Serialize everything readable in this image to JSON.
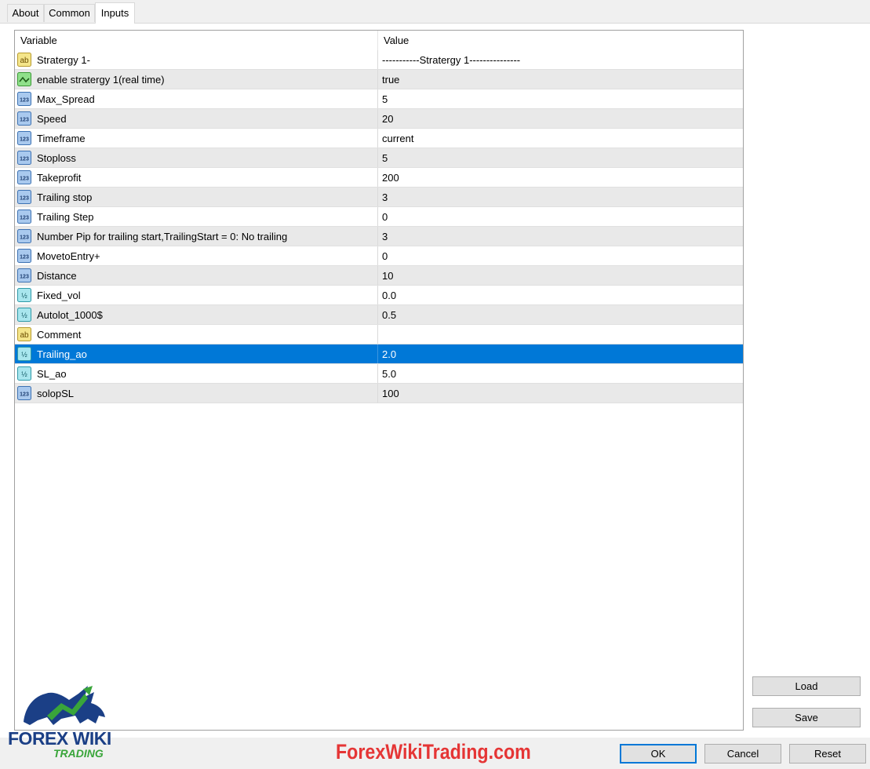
{
  "tabs": [
    {
      "label": "About"
    },
    {
      "label": "Common"
    },
    {
      "label": "Inputs"
    }
  ],
  "grid": {
    "headers": {
      "variable": "Variable",
      "value": "Value"
    },
    "rows": [
      {
        "name": "Stratergy 1-",
        "value": "-----------Stratergy 1---------------",
        "icon": "string-ab-icon"
      },
      {
        "name": "enable stratergy 1(real time)",
        "value": "true",
        "icon": "bool-toggle-icon"
      },
      {
        "name": "Max_Spread",
        "value": "5",
        "icon": "integer-123-icon"
      },
      {
        "name": "Speed",
        "value": "20",
        "icon": "integer-123-icon"
      },
      {
        "name": "Timeframe",
        "value": "current",
        "icon": "integer-123-icon"
      },
      {
        "name": "Stoploss",
        "value": "5",
        "icon": "integer-123-icon"
      },
      {
        "name": "Takeprofit",
        "value": "200",
        "icon": "integer-123-icon"
      },
      {
        "name": "Trailing stop",
        "value": "3",
        "icon": "integer-123-icon"
      },
      {
        "name": "Trailing Step",
        "value": "0",
        "icon": "integer-123-icon"
      },
      {
        "name": "Number Pip for trailing start,TrailingStart = 0: No trailing",
        "value": "3",
        "icon": "integer-123-icon"
      },
      {
        "name": "MovetoEntry+",
        "value": "0",
        "icon": "integer-123-icon"
      },
      {
        "name": "Distance",
        "value": "10",
        "icon": "integer-123-icon"
      },
      {
        "name": "Fixed_vol",
        "value": "0.0",
        "icon": "double-half-icon"
      },
      {
        "name": "Autolot_1000$",
        "value": "0.5",
        "icon": "double-half-icon"
      },
      {
        "name": "Comment",
        "value": "",
        "icon": "string-ab-icon"
      },
      {
        "name": "Trailing_ao",
        "value": "2.0",
        "icon": "double-half-icon",
        "selected": true
      },
      {
        "name": "SL_ao",
        "value": "5.0",
        "icon": "double-half-icon"
      },
      {
        "name": "solopSL",
        "value": "100",
        "icon": "integer-123-icon"
      }
    ]
  },
  "buttons": {
    "load": "Load",
    "save": "Save",
    "ok": "OK",
    "cancel": "Cancel",
    "reset": "Reset"
  },
  "watermark": "ForexWikiTrading.com",
  "logo": {
    "line1": "FOREX WIKI",
    "line2": "TRADING"
  },
  "colors": {
    "selection": "#0078d7",
    "watermark": "#e53535",
    "logo_blue": "#1b3f86",
    "logo_green": "#39a53a"
  }
}
